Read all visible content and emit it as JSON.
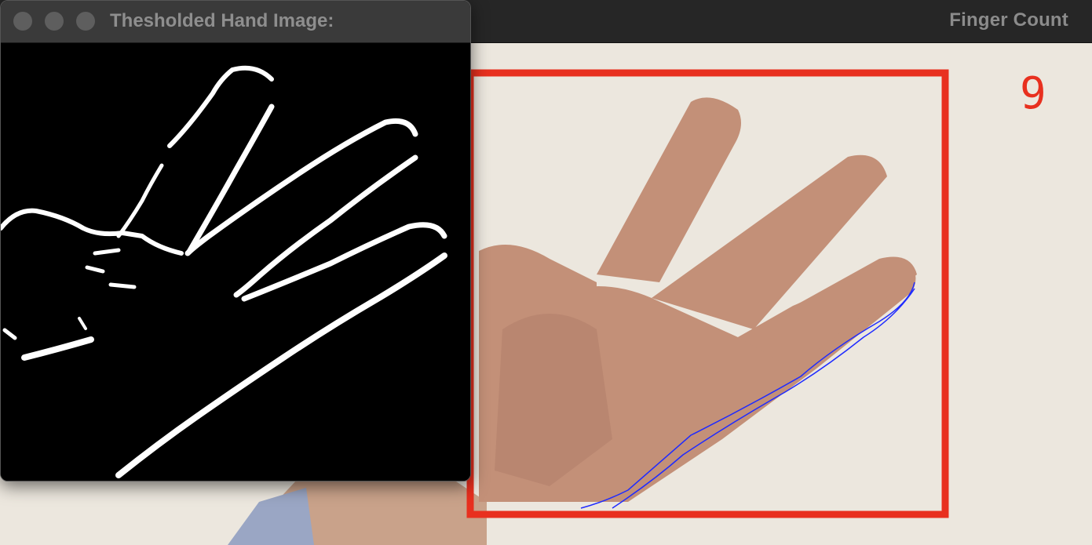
{
  "windows": {
    "finger_count": {
      "title": "Finger Count",
      "finger_count_value": "9",
      "colors": {
        "bounding_box": "#e8301f",
        "contour": "#1f2bff",
        "wall": "#ece7de"
      }
    },
    "threshold": {
      "title": "Thesholded Hand Image:",
      "colors": {
        "background": "#000000",
        "edges": "#ffffff"
      }
    }
  }
}
